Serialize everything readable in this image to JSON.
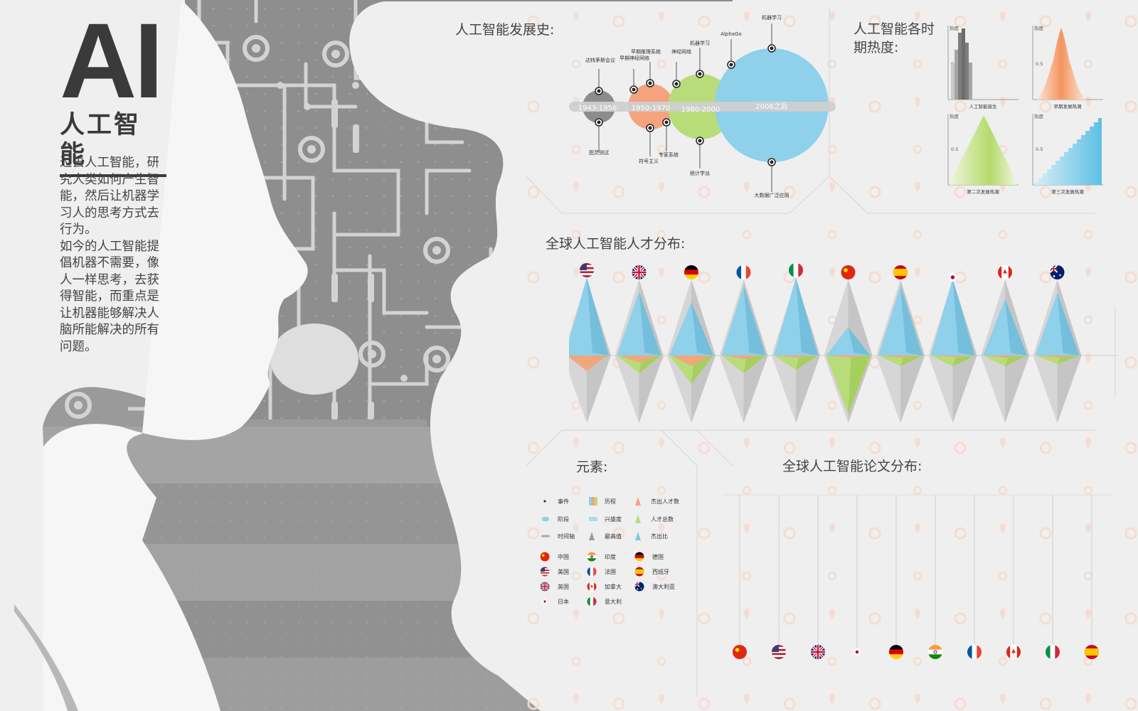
{
  "hero": {
    "title": "AI",
    "subtitle": "人工智能",
    "paragraphs": [
      "过去人工智能，研究人类如何产生智能，然后让机器学习人的思考方式去行为。",
      "如今的人工智能提倡机器不需要，像人一样思考，去获得智能，而重点是让机器能够解决人脑所能解决的所有问题。"
    ]
  },
  "history": {
    "title": "人工智能发展史:",
    "periods": [
      {
        "label": "1943-1956",
        "color": "#8c8c8c"
      },
      {
        "label": "1950-1970",
        "color": "#f5a27e"
      },
      {
        "label": "1980-2000",
        "color": "#b9dc7a"
      },
      {
        "label": "2006之后",
        "color": "#8fd0ea"
      }
    ],
    "events": [
      "达特茅斯会议",
      "图灵测试",
      "早期神经网络",
      "早期推理系统",
      "符号主义",
      "神经网络",
      "专家系统",
      "机器学习",
      "统计学派",
      "AlphaGo",
      "机器学习",
      "大数据广泛应用"
    ]
  },
  "heat": {
    "title_line1": "人工智能各时",
    "title_line2": "期热度:",
    "axis_label": "热度",
    "tick_label": "0.5",
    "panels": [
      {
        "name": "人工智能诞生",
        "color": "#7d7d7d"
      },
      {
        "name": "早期发展热潮",
        "color": "#f4955f"
      },
      {
        "name": "第二次发展热潮",
        "color": "#b5da6b"
      },
      {
        "name": "第三次发展热潮",
        "color": "#63c4e6"
      }
    ]
  },
  "talent": {
    "title": "全球人工智能人才分布:",
    "countries": [
      "us",
      "uk",
      "de",
      "fr",
      "it",
      "cn",
      "es",
      "jp",
      "ca",
      "au"
    ]
  },
  "legend": {
    "title": "元素:",
    "items": [
      {
        "icon": "dot",
        "label": "事件"
      },
      {
        "icon": "bars",
        "label": "历程"
      },
      {
        "icon": "tri-orange",
        "label": "杰出人才数"
      },
      {
        "icon": "pill",
        "label": "阶段"
      },
      {
        "icon": "flat-bars",
        "label": "兴盛度"
      },
      {
        "icon": "tri-green",
        "label": "人才总数"
      },
      {
        "icon": "line",
        "label": "时间轴"
      },
      {
        "icon": "tri-gray",
        "label": "最高值"
      },
      {
        "icon": "tri-blue",
        "label": "杰出比"
      }
    ],
    "countries": [
      {
        "code": "cn",
        "label": "中国"
      },
      {
        "code": "in",
        "label": "印度"
      },
      {
        "code": "de",
        "label": "德国"
      },
      {
        "code": "us",
        "label": "美国"
      },
      {
        "code": "fr",
        "label": "法国"
      },
      {
        "code": "es",
        "label": "西班牙"
      },
      {
        "code": "uk",
        "label": "英国"
      },
      {
        "code": "ca",
        "label": "加拿大"
      },
      {
        "code": "au",
        "label": "澳大利亚"
      },
      {
        "code": "jp",
        "label": "日本"
      },
      {
        "code": "it",
        "label": "意大利"
      }
    ]
  },
  "papers": {
    "title": "全球人工智能论文分布:",
    "countries": [
      "cn",
      "us",
      "uk",
      "jp",
      "de",
      "in",
      "fr",
      "ca",
      "it",
      "es"
    ]
  },
  "colors": {
    "orange": "#f5a27e",
    "green": "#b9dc7a",
    "blue": "#8fd0ea",
    "gray": "#8c8c8c",
    "dark": "#3a3a3a"
  }
}
